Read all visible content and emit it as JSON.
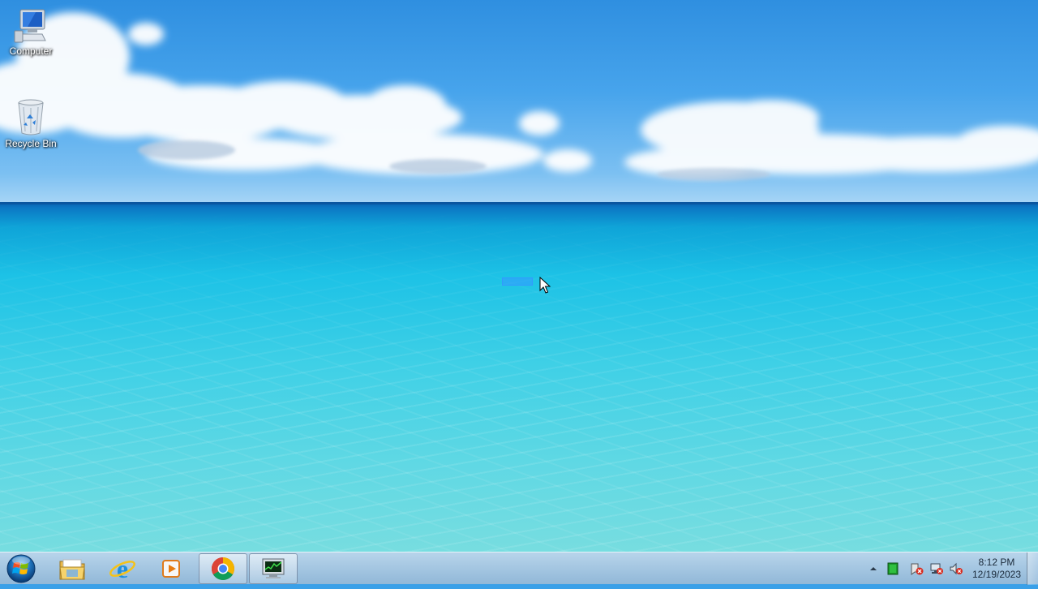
{
  "desktop": {
    "icons": [
      {
        "label": "Computer",
        "icon": "computer-icon"
      },
      {
        "label": "Recycle Bin",
        "icon": "recycle-bin-icon"
      }
    ]
  },
  "taskbar": {
    "start": {
      "icon": "windows-logo-icon"
    },
    "pinned": [
      {
        "name": "Windows Explorer",
        "icon": "folder-icon",
        "active": false
      },
      {
        "name": "Internet Explorer",
        "icon": "internet-explorer-icon",
        "active": false
      },
      {
        "name": "Windows Media Player",
        "icon": "media-player-icon",
        "active": false
      },
      {
        "name": "Google Chrome",
        "icon": "chrome-icon",
        "active": true
      },
      {
        "name": "Task Manager",
        "icon": "task-manager-icon",
        "active": true
      }
    ],
    "tray": {
      "icons": [
        "show-hidden-icons-arrow",
        "green-app-icon",
        "action-center-alert-icon",
        "network-alert-icon",
        "volume-muted-icon"
      ]
    },
    "clock": {
      "time": "8:12 PM",
      "date": "12/19/2023"
    }
  },
  "colors": {
    "sky": "#47a4ec",
    "sea": "#1dc2e6",
    "selection": "#3399ff"
  }
}
